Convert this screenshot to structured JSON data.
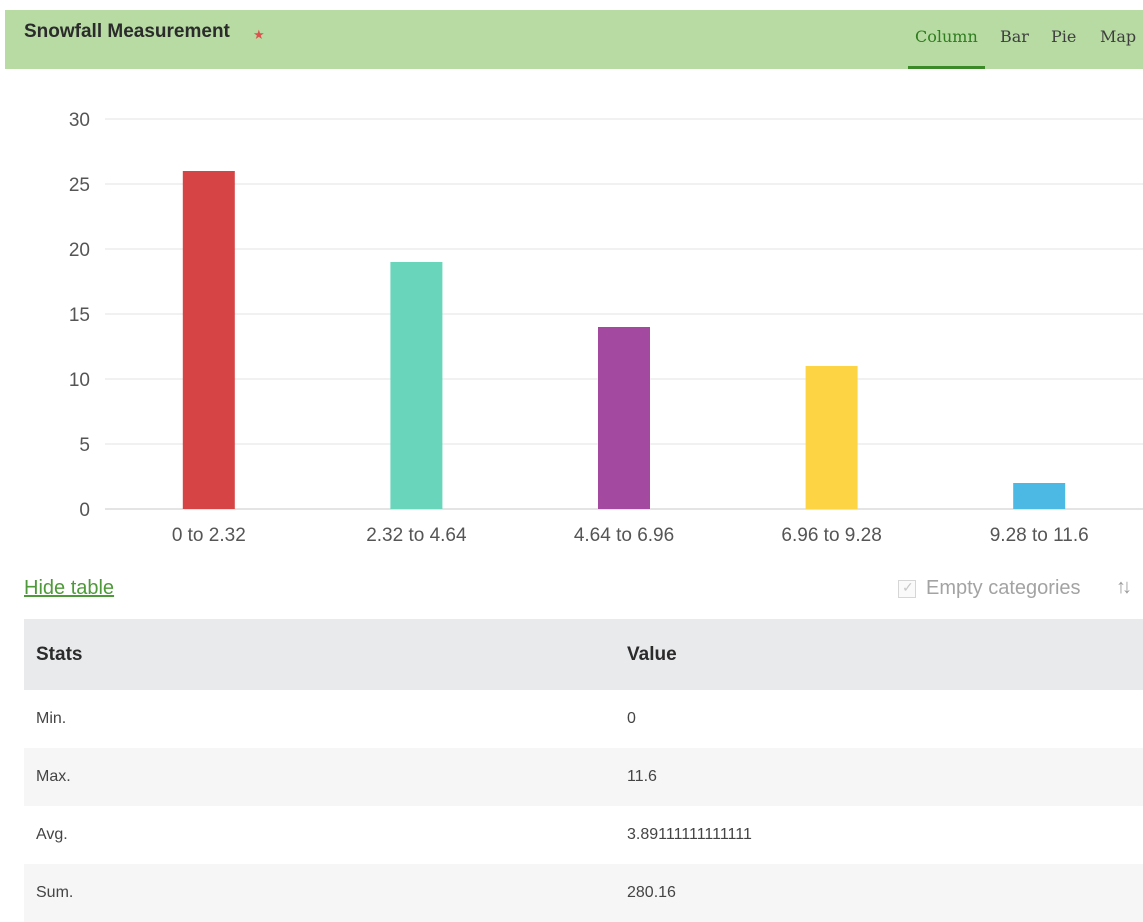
{
  "header": {
    "title": "Snowfall Measurement",
    "required_marker": "★",
    "tabs": [
      {
        "label": "Column",
        "active": true
      },
      {
        "label": "Bar",
        "active": false
      },
      {
        "label": "Pie",
        "active": false
      },
      {
        "label": "Map",
        "active": false
      }
    ]
  },
  "chart_data": {
    "type": "bar",
    "categories": [
      "0 to 2.32",
      "2.32 to 4.64",
      "4.64 to 6.96",
      "6.96 to 9.28",
      "9.28 to 11.6"
    ],
    "values": [
      26,
      19,
      14,
      11,
      2
    ],
    "colors": [
      "#d64445",
      "#69d6bb",
      "#a449a0",
      "#fdd544",
      "#4bb9e3"
    ],
    "ylim": [
      0,
      30
    ],
    "yticks": [
      0,
      5,
      10,
      15,
      20,
      25,
      30
    ],
    "grid": true
  },
  "controls": {
    "hide_table": "Hide table",
    "empty_categories": "Empty categories",
    "empty_categories_checked": true,
    "sort_icon": "sort-icon"
  },
  "table": {
    "headers": [
      "Stats",
      "Value"
    ],
    "rows": [
      [
        "Min.",
        "0"
      ],
      [
        "Max.",
        "11.6"
      ],
      [
        "Avg.",
        "3.89111111111111"
      ],
      [
        "Sum.",
        "280.16"
      ]
    ]
  }
}
